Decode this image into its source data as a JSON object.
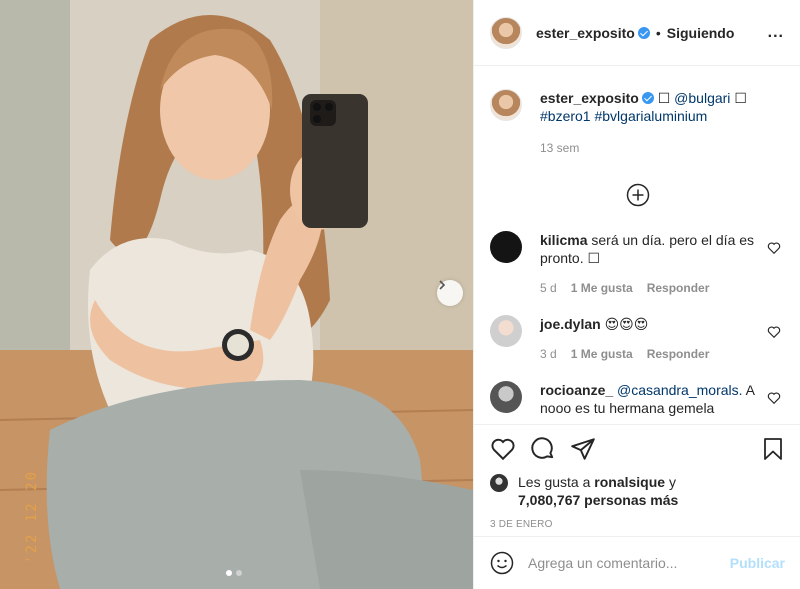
{
  "post": {
    "date_stamp": "'22 12 20",
    "carousel_count": 2,
    "carousel_active": 1
  },
  "header": {
    "username": "ester_exposito",
    "separator": "•",
    "follow_label": "Siguiendo",
    "more_label": "..."
  },
  "caption": {
    "username": "ester_exposito",
    "box1": "☐",
    "mention": "@bulgari",
    "box2": "☐",
    "hashtags": "#bzero1 #bvlgarialuminium",
    "age": "13 sem"
  },
  "comments": [
    {
      "user": "kilicma",
      "text": "será un día. pero el día es pronto. ☐",
      "age": "5 d",
      "likes": "1 Me gusta",
      "reply": "Responder"
    },
    {
      "user": "joe.dylan",
      "text": "😍😍😍",
      "age": "3 d",
      "likes": "1 Me gusta",
      "reply": "Responder"
    },
    {
      "user": "rocioanze_",
      "mention": "@casandra_morals.",
      "text": "A nooo es tu hermana gemela"
    }
  ],
  "likes": {
    "prefix": "Les gusta a",
    "user": "ronalsique",
    "y": "y",
    "count": "7,080,767 personas más"
  },
  "post_date": "3 DE ENERO",
  "comment_box": {
    "placeholder": "Agrega un comentario...",
    "publish": "Publicar"
  },
  "colors": {
    "accent": "#3897f0",
    "publish_disabled": "#b2dffc",
    "link": "#00376b"
  }
}
